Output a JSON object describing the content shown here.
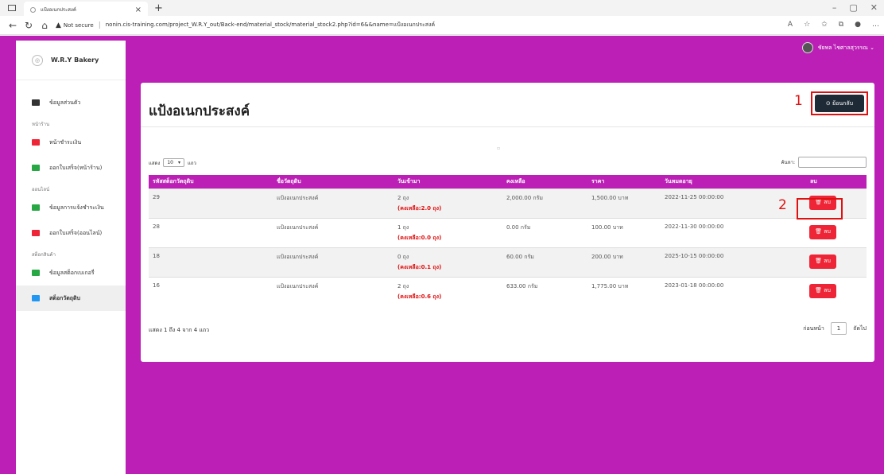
{
  "browser": {
    "tab_title": "แป้งอเนกประสงค์",
    "not_secure": "Not secure",
    "url": "nonin.cis-training.com/project_W.R.Y_out/Back-end/material_stock/material_stock2.php?id=6&&name=แป้งอเนกประสงค์"
  },
  "sidebar": {
    "brand": "W.R.Y Bakery",
    "items": [
      {
        "label": "ข้อมูลส่วนตัว",
        "color": "#333333"
      },
      {
        "header": "หน้าร้าน"
      },
      {
        "label": "หน้าชำระเงิน",
        "color": "#ee2536"
      },
      {
        "label": "ออกใบเสร็จ(หน้าร้าน)",
        "color": "#28a745"
      },
      {
        "header": "ออนไลน์"
      },
      {
        "label": "ข้อมูลการแจ้งชำระเงิน",
        "color": "#28a745"
      },
      {
        "label": "ออกใบเสร็จ(ออนไลน์)",
        "color": "#ee2536"
      },
      {
        "header": "สต็อกสินค้า"
      },
      {
        "label": "ข้อมูลสต็อกเบเกอรี่",
        "color": "#28a745"
      },
      {
        "label": "สต็อกวัตถุดิบ",
        "color": "#2196f3"
      }
    ]
  },
  "user": {
    "name": "ชัยพล ไชศาลสุวรรณ ⌄"
  },
  "card": {
    "title": "แป้งอเนกประสงค์",
    "back_label": "⊙ ย้อนกลับ",
    "tiny_mark": "▫",
    "annotation1": "1",
    "annotation2": "2",
    "length_prefix": "แสดง",
    "length_value": "10",
    "length_suffix": "แถว",
    "search_label": "ค้นหา:",
    "info": "แสดง 1 ถึง 4 จาก 4 แถว",
    "prev": "ก่อนหน้า",
    "page": "1",
    "next": "ถัดไป"
  },
  "table": {
    "headers": [
      "รหัสสต็อกวัตถุดิบ",
      "ชื่อวัตถุดิบ",
      "วันเข้ามา",
      "คงเหลือ",
      "ราคา",
      "วันหมดอายุ",
      "ลบ"
    ],
    "rows": [
      {
        "id": "29",
        "name": "แป้งอเนกประสงค์",
        "qty": "2 ถุง",
        "remain": "(คงเหลือ:2.0 ถุง)",
        "left": "2,000.00 กรัม",
        "price": "1,500.00 บาท",
        "exp": "2022-11-25 00:00:00",
        "del": "🗑 ลบ"
      },
      {
        "id": "28",
        "name": "แป้งอเนกประสงค์",
        "qty": "1 ถุง",
        "remain": "(คงเหลือ:0.0 ถุง)",
        "left": "0.00 กรัม",
        "price": "100.00 บาท",
        "exp": "2022-11-30 00:00:00",
        "del": "🗑 ลบ"
      },
      {
        "id": "18",
        "name": "แป้งอเนกประสงค์",
        "qty": "0 ถุง",
        "remain": "(คงเหลือ:0.1 ถุง)",
        "left": "60.00 กรัม",
        "price": "200.00 บาท",
        "exp": "2025-10-15 00:00:00",
        "del": "🗑 ลบ"
      },
      {
        "id": "16",
        "name": "แป้งอเนกประสงค์",
        "qty": "2 ถุง",
        "remain": "(คงเหลือ:0.6 ถุง)",
        "left": "633.00 กรัม",
        "price": "1,775.00 บาท",
        "exp": "2023-01-18 00:00:00",
        "del": "🗑 ลบ"
      }
    ]
  }
}
